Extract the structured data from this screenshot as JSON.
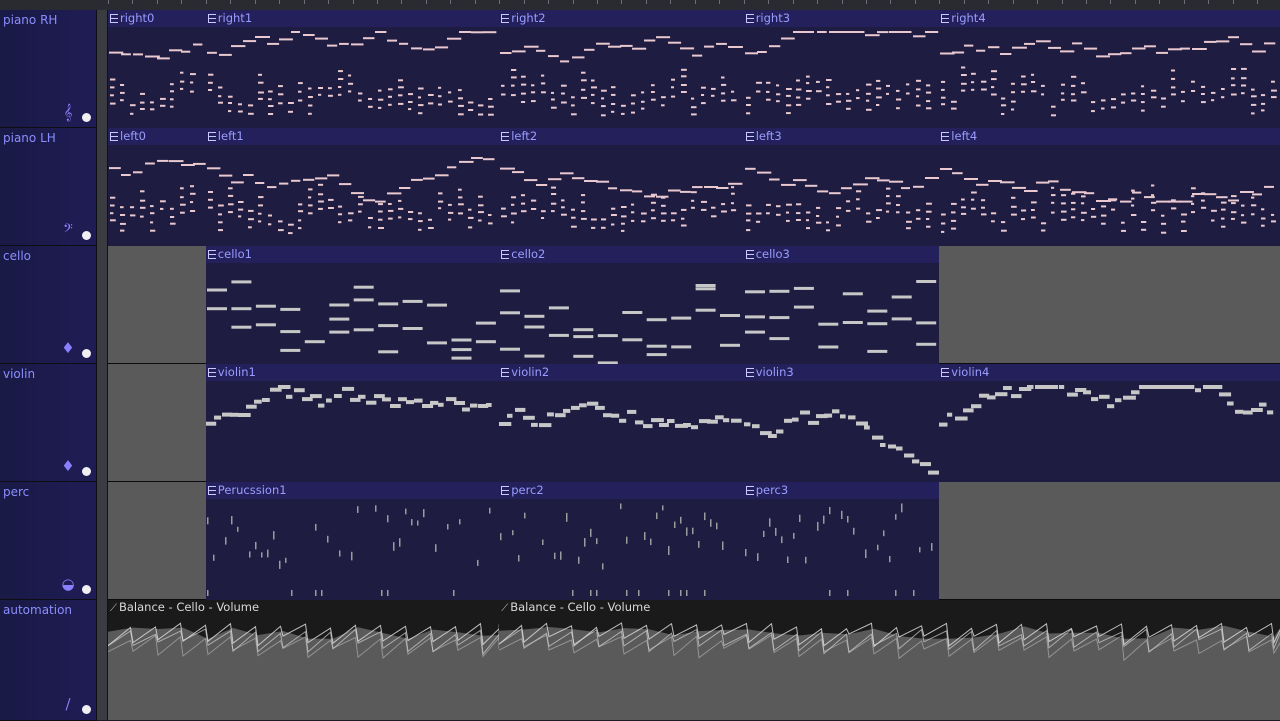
{
  "tracks": [
    {
      "id": "piano_rh",
      "name": "piano RH",
      "icon": "treble-clef-icon",
      "glyph": "𝄞",
      "icon_color": "#8a7fff"
    },
    {
      "id": "piano_lh",
      "name": "piano LH",
      "icon": "bass-clef-icon",
      "glyph": "𝄢",
      "icon_color": "#8a7fff"
    },
    {
      "id": "cello",
      "name": "cello",
      "icon": "cello-icon",
      "glyph": "♦",
      "icon_color": "#8a7fff"
    },
    {
      "id": "violin",
      "name": "violin",
      "icon": "violin-icon",
      "glyph": "♦",
      "icon_color": "#8a7fff"
    },
    {
      "id": "perc",
      "name": "perc",
      "icon": "drum-icon",
      "glyph": "◒",
      "icon_color": "#8a7fff"
    },
    {
      "id": "automation",
      "name": "automation",
      "icon": "automation-link-icon",
      "glyph": "∕",
      "icon_color": "#8a7fff"
    }
  ],
  "clips": {
    "piano_rh": [
      {
        "label": "right0",
        "start": 0,
        "end": 4
      },
      {
        "label": "right1",
        "start": 4,
        "end": 16
      },
      {
        "label": "right2",
        "start": 16,
        "end": 26
      },
      {
        "label": "right3",
        "start": 26,
        "end": 34
      },
      {
        "label": "right4",
        "start": 34,
        "end": 48
      }
    ],
    "piano_lh": [
      {
        "label": "left0",
        "start": 0,
        "end": 4
      },
      {
        "label": "left1",
        "start": 4,
        "end": 16
      },
      {
        "label": "left2",
        "start": 16,
        "end": 26
      },
      {
        "label": "left3",
        "start": 26,
        "end": 34
      },
      {
        "label": "left4",
        "start": 34,
        "end": 48
      }
    ],
    "cello": [
      {
        "label": "cello1",
        "start": 4,
        "end": 16
      },
      {
        "label": "cello2",
        "start": 16,
        "end": 26
      },
      {
        "label": "cello3",
        "start": 26,
        "end": 34
      }
    ],
    "violin": [
      {
        "label": "violin1",
        "start": 4,
        "end": 16
      },
      {
        "label": "violin2",
        "start": 16,
        "end": 26
      },
      {
        "label": "violin3",
        "start": 26,
        "end": 34
      },
      {
        "label": "violin4",
        "start": 34,
        "end": 48
      }
    ],
    "perc": [
      {
        "label": "Perucssion1",
        "start": 4,
        "end": 16
      },
      {
        "label": "perc2",
        "start": 16,
        "end": 26
      },
      {
        "label": "perc3",
        "start": 26,
        "end": 34
      }
    ]
  },
  "automation_clips": [
    {
      "label": "Balance - Cello - Volume",
      "start": 0,
      "end": 16
    },
    {
      "label": "Balance - Cello - Volume",
      "start": 16,
      "end": 48
    }
  ],
  "colors": {
    "clip_title_bg": "#24205c",
    "clip_body_bg": "#1e1c40",
    "clip_title_text": "#9a9dff",
    "note_piano": "#e9c9cf",
    "note_strings": "#c7c7c7",
    "note_perc": "#9c9c9c",
    "empty_lane": "#5a5a5a",
    "track_header_bg": "#191a45",
    "track_header_text": "#8a8dff",
    "automation_fill": "#5a5a5a",
    "automation_line": "#dadada"
  }
}
